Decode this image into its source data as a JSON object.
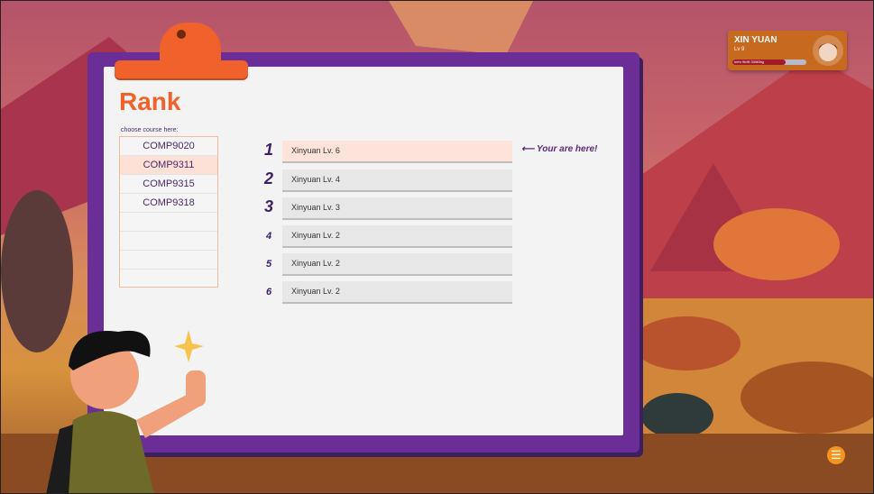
{
  "rank_panel": {
    "title": "Rank",
    "choose_label": "choose course here:",
    "courses": [
      "COMP9020",
      "COMP9311",
      "COMP9315",
      "COMP9318"
    ],
    "selected_course": "COMP9311",
    "rows": [
      {
        "rank": "1",
        "text": "Xinyuan  Lv. 6"
      },
      {
        "rank": "2",
        "text": "Xinyuan  Lv. 4"
      },
      {
        "rank": "3",
        "text": "Xinyuan  Lv. 3"
      },
      {
        "rank": "4",
        "text": "Xinyuan  Lv. 2"
      },
      {
        "rank": "5",
        "text": "Xinyuan  Lv. 2"
      },
      {
        "rank": "6",
        "text": "Xinyuan  Lv. 2"
      }
    ],
    "you_are_here": "Your are here!",
    "arrow_icon": "left-arrow-icon"
  },
  "user": {
    "name": "XIN YUAN",
    "level": "Lv 9",
    "xp_text": "mfm 9h/fll 33/60bg",
    "xp_fraction": 0.72
  },
  "menu_icon": "menu-icon",
  "colors": {
    "accent": "#f0612b",
    "board": "#6a2e96",
    "highlight": "#fde3d9",
    "user_card": "#c76a1f"
  }
}
